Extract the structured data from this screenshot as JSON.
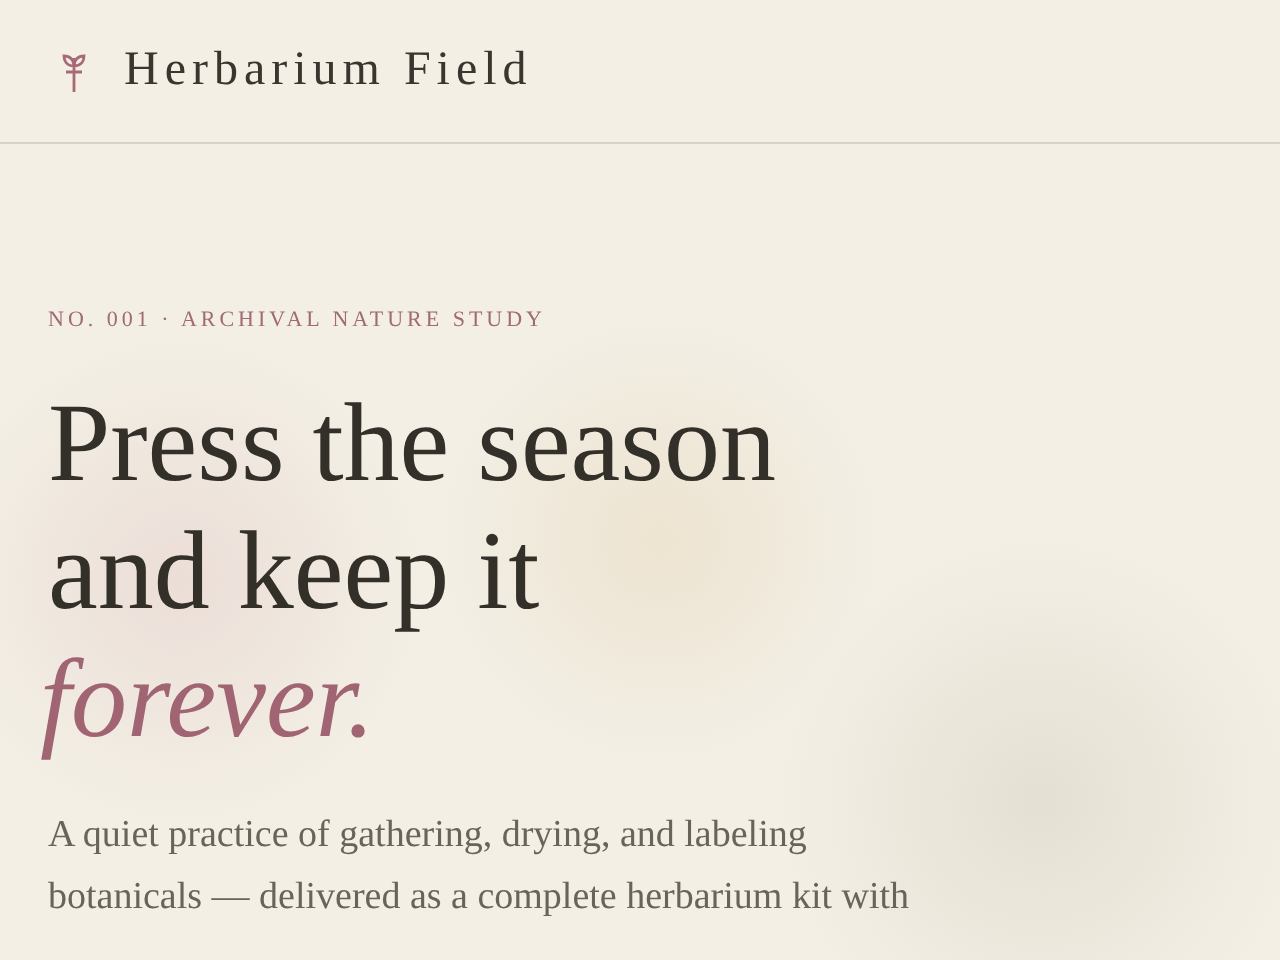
{
  "brand": {
    "name": "Herbarium Field"
  },
  "hero": {
    "eyebrow": "NO. 001 · ARCHIVAL NATURE STUDY",
    "headline_lines": [
      {
        "text": "Press the season",
        "kind": "plain"
      },
      {
        "text": "and keep it",
        "kind": "plain"
      },
      {
        "text": "forever.",
        "kind": "accent"
      }
    ],
    "lead": "A quiet practice of gathering, drying, and labeling botanicals — delivered as a complete herbarium kit with"
  }
}
